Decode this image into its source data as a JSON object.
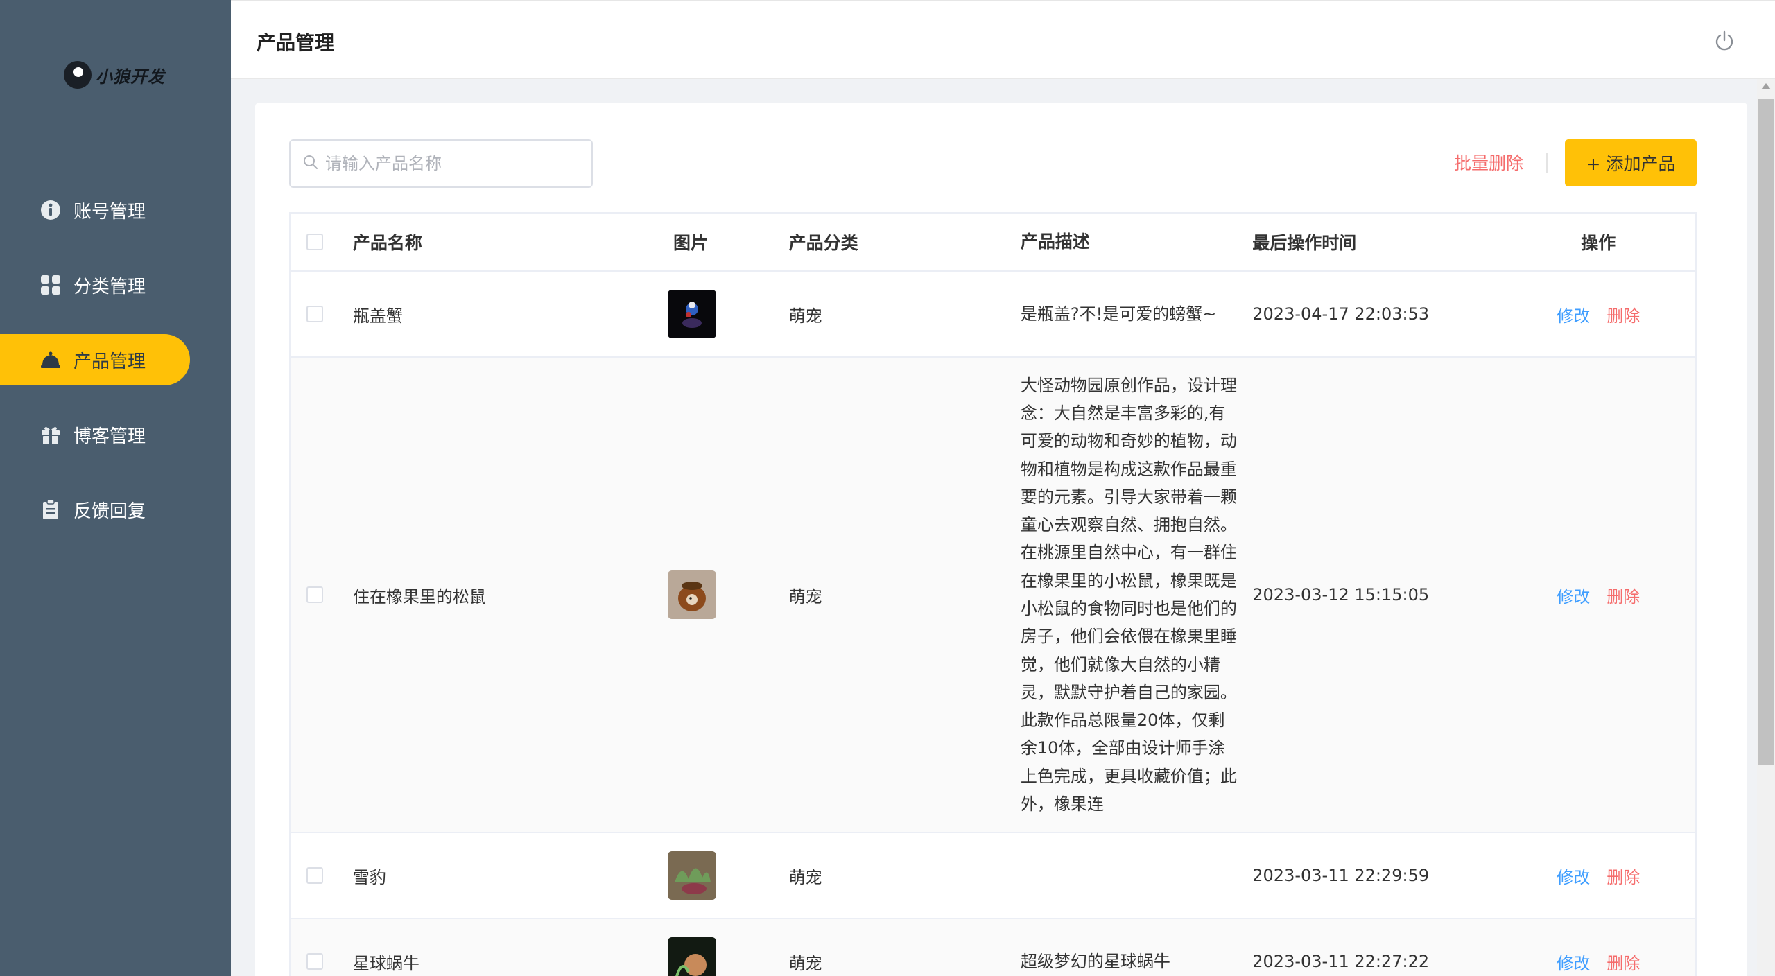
{
  "logo": {
    "text": "小狼开发"
  },
  "sidebar": {
    "items": [
      {
        "label": "账号管理",
        "icon": "account-info-icon",
        "active": false
      },
      {
        "label": "分类管理",
        "icon": "grid-icon",
        "active": false
      },
      {
        "label": "产品管理",
        "icon": "bell-icon",
        "active": true
      },
      {
        "label": "博客管理",
        "icon": "gift-icon",
        "active": false
      },
      {
        "label": "反馈回复",
        "icon": "clipboard-icon",
        "active": false
      }
    ]
  },
  "header": {
    "title": "产品管理",
    "power_icon": "power-icon"
  },
  "toolbar": {
    "search_placeholder": "请输入产品名称",
    "batch_delete_label": "批量删除",
    "add_label": "+ 添加产品"
  },
  "table": {
    "columns": [
      "产品名称",
      "图片",
      "产品分类",
      "产品描述",
      "最后操作时间",
      "操作"
    ],
    "rows": [
      {
        "name": "瓶盖蟹",
        "category": "萌宠",
        "description": "是瓶盖?不!是可爱的螃蟹~",
        "time": "2023-04-17 22:03:53",
        "edit": "修改",
        "delete": "删除"
      },
      {
        "name": "住在橡果里的松鼠",
        "category": "萌宠",
        "description": "大怪动物园原创作品，设计理念：大自然是丰富多彩的,有可爱的动物和奇妙的植物，动物和植物是构成这款作品最重要的元素。引导大家带着一颗童心去观察自然、拥抱自然。在桃源里自然中心，有一群住在橡果里的小松鼠，橡果既是小松鼠的食物同时也是他们的房子，他们会依偎在橡果里睡觉，他们就像大自然的小精灵，默默守护着自己的家园。此款作品总限量20体，仅剩余10体，全部由设计师手涂上色完成，更具收藏价值；此外，橡果连",
        "time": "2023-03-12 15:15:05",
        "edit": "修改",
        "delete": "删除"
      },
      {
        "name": "雪豹",
        "category": "萌宠",
        "description": "",
        "time": "2023-03-11 22:29:59",
        "edit": "修改",
        "delete": "删除"
      },
      {
        "name": "星球蜗牛",
        "category": "萌宠",
        "description": "超级梦幻的星球蜗牛",
        "time": "2023-03-11 22:27:22",
        "edit": "修改",
        "delete": "删除"
      }
    ]
  }
}
